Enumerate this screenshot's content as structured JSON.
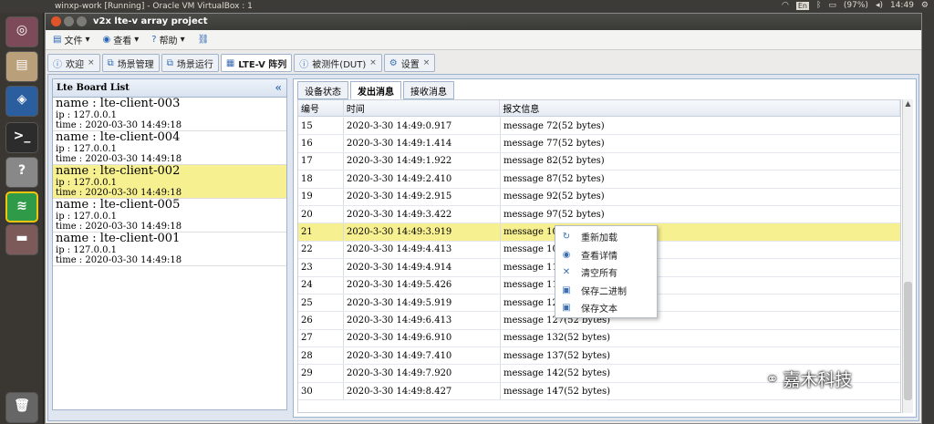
{
  "os": {
    "vm_title": "winxp-work [Running] - Oracle VM VirtualBox : 1",
    "input_lang": "En",
    "battery": "(97%)",
    "clock": "14:49"
  },
  "window": {
    "title": "v2x lte-v array project"
  },
  "menu": [
    {
      "label": "文件",
      "icon": "file-icon"
    },
    {
      "label": "查看",
      "icon": "eye-icon"
    },
    {
      "label": "帮助",
      "icon": "help-icon"
    }
  ],
  "tabs": [
    {
      "label": "欢迎",
      "icon": "info-icon",
      "closable": true
    },
    {
      "label": "场景管理",
      "icon": "puzzle-icon",
      "closable": false
    },
    {
      "label": "场景运行",
      "icon": "puzzle-icon",
      "closable": false
    },
    {
      "label": "LTE-V 阵列",
      "icon": "grid-icon",
      "closable": false,
      "active": true
    },
    {
      "label": "被测件(DUT)",
      "icon": "info-icon",
      "closable": true
    },
    {
      "label": "设置",
      "icon": "gear-icon",
      "closable": true
    }
  ],
  "board_list": {
    "title": "Lte Board List",
    "boards": [
      {
        "name": "name : lte-client-003",
        "ip": "ip : 127.0.0.1",
        "time": "time : 2020-03-30 14:49:18"
      },
      {
        "name": "name : lte-client-004",
        "ip": "ip : 127.0.0.1",
        "time": "time : 2020-03-30 14:49:18"
      },
      {
        "name": "name : lte-client-002",
        "ip": "ip : 127.0.0.1",
        "time": "time : 2020-03-30 14:49:18",
        "selected": true
      },
      {
        "name": "name : lte-client-005",
        "ip": "ip : 127.0.0.1",
        "time": "time : 2020-03-30 14:49:18"
      },
      {
        "name": "name : lte-client-001",
        "ip": "ip : 127.0.0.1",
        "time": "time : 2020-03-30 14:49:18"
      }
    ]
  },
  "subtabs": [
    {
      "label": "设备状态"
    },
    {
      "label": "发出消息",
      "active": true
    },
    {
      "label": "接收消息"
    }
  ],
  "grid": {
    "columns": [
      "编号",
      "时间",
      "报文信息"
    ],
    "rows": [
      [
        "15",
        "2020-3-30 14:49:0.917",
        "message 72(52 bytes)"
      ],
      [
        "16",
        "2020-3-30 14:49:1.414",
        "message 77(52 bytes)"
      ],
      [
        "17",
        "2020-3-30 14:49:1.922",
        "message 82(52 bytes)"
      ],
      [
        "18",
        "2020-3-30 14:49:2.410",
        "message 87(52 bytes)"
      ],
      [
        "19",
        "2020-3-30 14:49:2.915",
        "message 92(52 bytes)"
      ],
      [
        "20",
        "2020-3-30 14:49:3.422",
        "message 97(52 bytes)"
      ],
      [
        "21",
        "2020-3-30 14:49:3.919",
        "message 102(5",
        true
      ],
      [
        "22",
        "2020-3-30 14:49:4.413",
        "message 107(5"
      ],
      [
        "23",
        "2020-3-30 14:49:4.914",
        "message 112(5"
      ],
      [
        "24",
        "2020-3-30 14:49:5.426",
        "message 117(5"
      ],
      [
        "25",
        "2020-3-30 14:49:5.919",
        "message 122(5"
      ],
      [
        "26",
        "2020-3-30 14:49:6.413",
        "message 127(52 bytes)"
      ],
      [
        "27",
        "2020-3-30 14:49:6.910",
        "message 132(52 bytes)"
      ],
      [
        "28",
        "2020-3-30 14:49:7.410",
        "message 137(52 bytes)"
      ],
      [
        "29",
        "2020-3-30 14:49:7.920",
        "message 142(52 bytes)"
      ],
      [
        "30",
        "2020-3-30 14:49:8.427",
        "message 147(52 bytes)"
      ]
    ]
  },
  "context_menu": [
    {
      "label": "重新加载",
      "icon": "reload-icon",
      "glyph": "↻"
    },
    {
      "label": "查看详情",
      "icon": "eye-icon",
      "glyph": "◉"
    },
    {
      "label": "清空所有",
      "icon": "clear-icon",
      "glyph": "✕"
    },
    {
      "label": "保存二进制",
      "icon": "save-icon",
      "glyph": "▣"
    },
    {
      "label": "保存文本",
      "icon": "save-icon",
      "glyph": "▣"
    }
  ],
  "watermark": "嘉木科技",
  "colors": {
    "selection": "#f7f091",
    "accent": "#3a6fb3"
  }
}
